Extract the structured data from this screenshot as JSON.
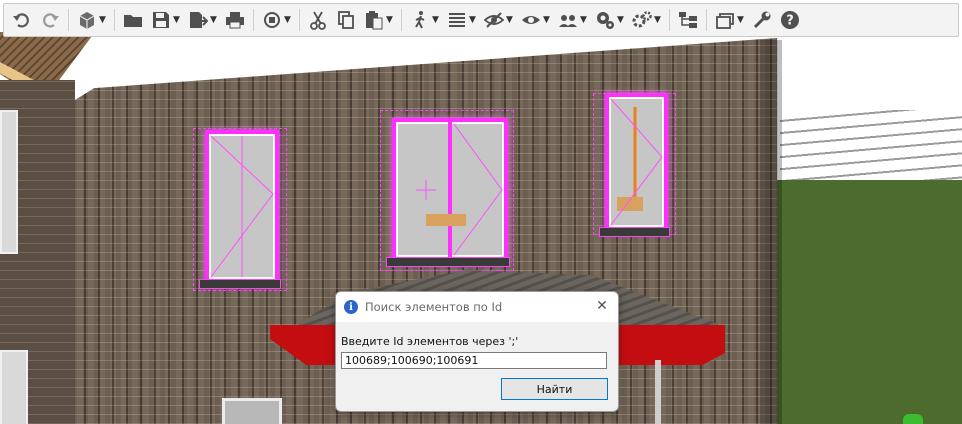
{
  "toolbar": {
    "items": [
      {
        "icon": "undo-icon"
      },
      {
        "icon": "redo-icon"
      },
      {
        "icon": "view-cube-icon",
        "dropdown": true
      },
      {
        "icon": "open-folder-icon"
      },
      {
        "icon": "save-icon",
        "dropdown": true
      },
      {
        "icon": "export-icon",
        "dropdown": true
      },
      {
        "icon": "print-icon"
      },
      {
        "icon": "orbit-icon",
        "dropdown": true
      },
      {
        "icon": "cut-icon"
      },
      {
        "icon": "copy-icon"
      },
      {
        "icon": "paste-icon",
        "dropdown": true
      },
      {
        "icon": "walk-icon",
        "dropdown": true
      },
      {
        "icon": "list-icon",
        "dropdown": true
      },
      {
        "icon": "hide-icon",
        "dropdown": true
      },
      {
        "icon": "show-icon",
        "dropdown": true
      },
      {
        "icon": "users-visibility-icon",
        "dropdown": true
      },
      {
        "icon": "settings-group-icon",
        "dropdown": true
      },
      {
        "icon": "settings-icon",
        "dropdown": true
      },
      {
        "icon": "hierarchy-icon"
      },
      {
        "icon": "layers-icon",
        "dropdown": true
      },
      {
        "icon": "wrench-icon"
      },
      {
        "icon": "help-icon"
      }
    ]
  },
  "dialog": {
    "title": "Поиск элементов по Id",
    "close_label": "✕",
    "info_glyph": "i",
    "prompt": "Введите Id элементов через ';'",
    "input_value": "100689;100690;100691",
    "button_label": "Найти"
  },
  "colors": {
    "selection_highlight": "#ff30ff",
    "canopy_red": "#c40d10",
    "toolbar_bg": "#f3f3f3",
    "dialog_accent": "#0078d7"
  }
}
